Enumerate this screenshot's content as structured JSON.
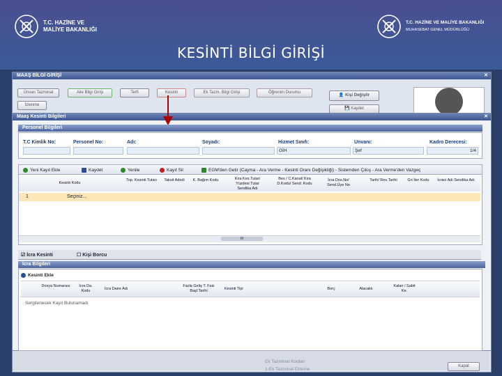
{
  "header": {
    "left_logo": {
      "line1": "T.C. HAZİNE VE",
      "line2": "MALİYE BAKANLIĞI"
    },
    "right_logo": {
      "line1": "T.C. HAZİNE VE MALİYE BAKANLIĞI",
      "line2": "MUHASEBAT GENEL MÜDÜRLÜĞÜ"
    },
    "title": "KESİNTİ BİLGİ GİRİŞİ"
  },
  "outer_window": {
    "title": "MAAŞ BİLGİ GİRİŞİ",
    "tabs": [
      "Ünvan Tazminat",
      "Aile Bilgi Girişi",
      "Terfi",
      "Kesinti",
      "Ek Tazm. Bilgi Girişi",
      "Öğrenim Durumu",
      "İzlenme"
    ],
    "person_search_button": "Kişi Değiştir",
    "save_button": "Kaydet",
    "footer_close": "Kapat",
    "footer_text": [
      "Ek Tazminat Kodları",
      "1-Ek Tazminat Ekleme"
    ]
  },
  "modal": {
    "title": "Maaş Kesinti Bilgileri",
    "personal_section": "Personel Bilgileri",
    "fields": {
      "tckn_label": "T.C Kimlik No:",
      "personnel_no_label": "Personel No:",
      "name_label": "Adı:",
      "surname_label": "Soyadı:",
      "service_class_label": "Hizmet Sınıfı:",
      "service_class_value": "GİH",
      "title_label": "Unvanı:",
      "title_value": "Şef",
      "degree_label": "Kadro Derecesi:",
      "degree_value": "1/4"
    },
    "toolbar": [
      {
        "label": "Yeni Kayıt Ekle",
        "icon": "add-icon",
        "color": "#2a8a2a"
      },
      {
        "label": "Kaydet",
        "icon": "save-icon",
        "color": "#2a4f9a"
      },
      {
        "label": "Yenile",
        "icon": "refresh-icon",
        "color": "#2a8a2a"
      },
      {
        "label": "Kayıt Sil",
        "icon": "delete-icon",
        "color": "#c02020"
      },
      {
        "label": "EGM'den Getir (Cayma - Ara Verme - Kesinti Oranı Değişikliği) - Sistemden Çıkış - Ara Verme'den Vazgeç",
        "icon": "import-icon",
        "color": "#2a8a2a"
      }
    ],
    "grid_columns": [
      "",
      "Kesinti Kodu",
      "Top. Kesinti Tutarı",
      "Taksit Adedi",
      "K. Bağım Kodu",
      "Kira Kes.Tutar/ Yüzdesi Tutar Sendika Adı",
      "Bes / C.Kanal/ Kira D.Kodu/ Send. Kodu",
      "İcra Dos.No/ Send.Üye No",
      "Tarih/ Res.Tarihi",
      "Gri İter Kodu",
      "İcraci Adı Sendika Adı"
    ],
    "grid_rows": [
      {
        "num": "1",
        "kesinti_kodu": "Seçiniz..."
      }
    ],
    "subtabs": [
      "İcra Kesinti",
      "Kişi Borcu"
    ],
    "icra_section": "İcra Bilgileri",
    "icra_add": "Kesinti Ekle",
    "icra_columns": [
      "Dosya Numarası",
      "İcra Da. Kodu",
      "İcra Daire Adı",
      "Fazla Geliş T. Faiz Başl.Tarihi",
      "Kesinti Tipi",
      "Borç",
      "Alacaklı",
      "Kalan / Sabit Ke."
    ],
    "icra_empty": "Sergilenecek Kayıt Bulunamadı"
  }
}
